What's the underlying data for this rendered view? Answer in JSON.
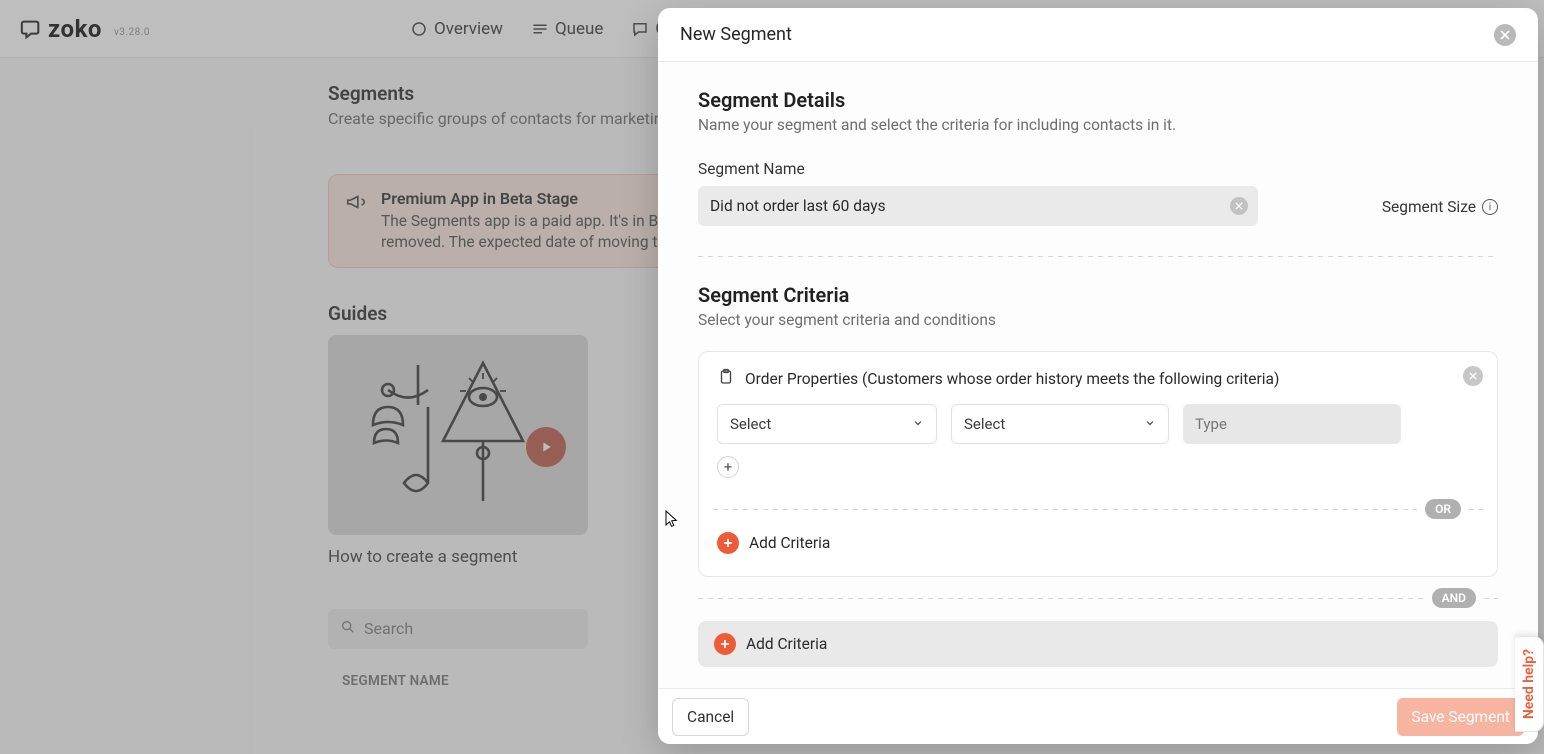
{
  "brand": {
    "name": "zoko",
    "version": "v3.28.0"
  },
  "nav": {
    "overview": "Overview",
    "queue": "Queue",
    "chat": "Chat"
  },
  "page": {
    "title": "Segments",
    "subtitle": "Create specific groups of contacts for marketing"
  },
  "banner": {
    "title": "Premium App in Beta Stage",
    "body": "The Segments app is a paid app. It's in BETA stage. You could use it for free until the BETA tag is removed. The expected date of moving the app from BETA to live is ..."
  },
  "guides": {
    "heading": "Guides",
    "card1": "How to create a segment"
  },
  "search": {
    "placeholder": "Search"
  },
  "table": {
    "col1": "SEGMENT NAME"
  },
  "modal": {
    "title": "New Segment",
    "details": {
      "heading": "Segment Details",
      "sub": "Name your segment and select the criteria for including contacts in it.",
      "name_label": "Segment Name",
      "name_value": "Did not order last 60 days",
      "size_label": "Segment Size"
    },
    "criteria": {
      "heading": "Segment Criteria",
      "sub": "Select your segment criteria and conditions",
      "card_title": "Order Properties (Customers whose order history meets the following criteria)",
      "select_placeholder": "Select",
      "type_placeholder": "Type",
      "or_label": "OR",
      "and_label": "AND",
      "add_label": "Add Criteria"
    },
    "footer": {
      "cancel": "Cancel",
      "save": "Save Segment"
    }
  },
  "help_tab": "Need help?"
}
